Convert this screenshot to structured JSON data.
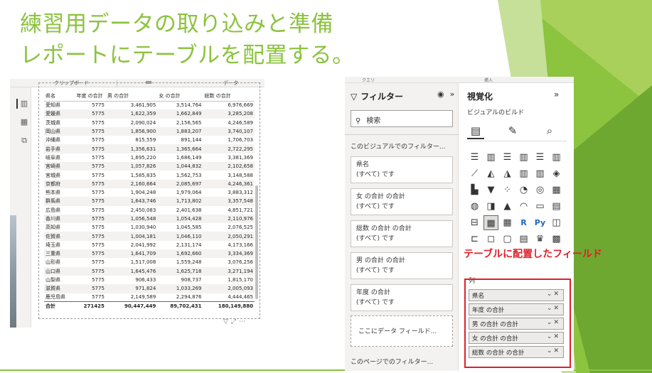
{
  "slide": {
    "title_line1": "練習用データの取り込みと準備",
    "title_line2": "レポートにテーブルを配置する。",
    "accent_color": "#8cc33f",
    "highlight_color": "#e0202a"
  },
  "left_ribbon": {
    "group1": "クリップボード",
    "group2": "データ"
  },
  "left_rail_icons": [
    "report-view-icon",
    "table-view-icon",
    "model-view-icon"
  ],
  "table": {
    "columns": [
      "県名",
      "年度 の合計",
      "男 の合計",
      "女 の合計",
      "総数 の合計"
    ],
    "rows": [
      [
        "愛知県",
        "5775",
        "3,461,905",
        "3,514,764",
        "6,976,669"
      ],
      [
        "愛媛県",
        "5775",
        "1,622,359",
        "1,662,849",
        "3,285,208"
      ],
      [
        "茨城県",
        "5775",
        "2,090,024",
        "2,156,565",
        "4,246,589"
      ],
      [
        "岡山県",
        "5775",
        "1,856,900",
        "1,883,207",
        "3,740,107"
      ],
      [
        "沖縄県",
        "5775",
        "815,559",
        "891,144",
        "1,706,703"
      ],
      [
        "岩手県",
        "5775",
        "1,356,631",
        "1,365,664",
        "2,722,295"
      ],
      [
        "岐阜県",
        "5775",
        "1,695,220",
        "1,686,149",
        "3,381,369"
      ],
      [
        "宮崎県",
        "5775",
        "1,057,826",
        "1,044,832",
        "2,102,658"
      ],
      [
        "宮城県",
        "5775",
        "1,585,835",
        "1,562,753",
        "3,148,588"
      ],
      [
        "京都府",
        "5775",
        "2,160,664",
        "2,085,697",
        "4,246,361"
      ],
      [
        "熊本県",
        "5775",
        "1,904,248",
        "1,979,064",
        "3,883,312"
      ],
      [
        "群馬県",
        "5775",
        "1,643,746",
        "1,713,802",
        "3,357,548"
      ],
      [
        "広島県",
        "5775",
        "2,450,083",
        "2,401,638",
        "4,851,721"
      ],
      [
        "香川県",
        "5775",
        "1,056,548",
        "1,054,428",
        "2,110,976"
      ],
      [
        "高知県",
        "5775",
        "1,030,940",
        "1,045,585",
        "2,076,525"
      ],
      [
        "佐賀県",
        "5775",
        "1,004,181",
        "1,046,110",
        "2,050,291"
      ],
      [
        "埼玉県",
        "5775",
        "2,041,992",
        "2,131,174",
        "4,173,166"
      ],
      [
        "三重県",
        "5775",
        "1,641,709",
        "1,692,660",
        "3,334,369"
      ],
      [
        "山形県",
        "5775",
        "1,517,008",
        "1,559,248",
        "3,076,256"
      ],
      [
        "山口県",
        "5775",
        "1,645,476",
        "1,625,718",
        "3,271,194"
      ],
      [
        "山梨県",
        "5775",
        "906,433",
        "908,737",
        "1,815,170"
      ],
      [
        "滋賀県",
        "5775",
        "971,824",
        "1,033,269",
        "2,005,093"
      ],
      [
        "鹿児島県",
        "5775",
        "2,149,589",
        "2,294,876",
        "4,444,465"
      ]
    ],
    "total": [
      "合計",
      "271425",
      "90,447,449",
      "89,702,431",
      "180,149,880"
    ]
  },
  "right_ribbon": {
    "group1": "クエリ",
    "group2": "挿入"
  },
  "filter_pane": {
    "title": "フィルター",
    "search_placeholder": "検索",
    "visual_section": "このビジュアルでのフィルター...",
    "cards": [
      {
        "name": "県名",
        "value": "(すべて) です"
      },
      {
        "name": "女 の合計 の合計",
        "value": "(すべて) です"
      },
      {
        "name": "総数 の合計 の合計",
        "value": "(すべて) です"
      },
      {
        "name": "男 の合計 の合計",
        "value": "(すべて) です"
      },
      {
        "name": "年度 の合計",
        "value": "(すべて) です"
      }
    ],
    "drop_zone": "ここにデータ フィールド...",
    "page_section": "このページでのフィルター..."
  },
  "viz_pane": {
    "title": "視覚化",
    "subtitle": "ビジュアルのビルド",
    "columns_label": "列",
    "fields": [
      "県名",
      "年度 の合計",
      "男 の合計 の合計",
      "女 の合計 の合計",
      "総数 の合計 の合計"
    ]
  },
  "callout": "テーブルに配置したフィールド"
}
